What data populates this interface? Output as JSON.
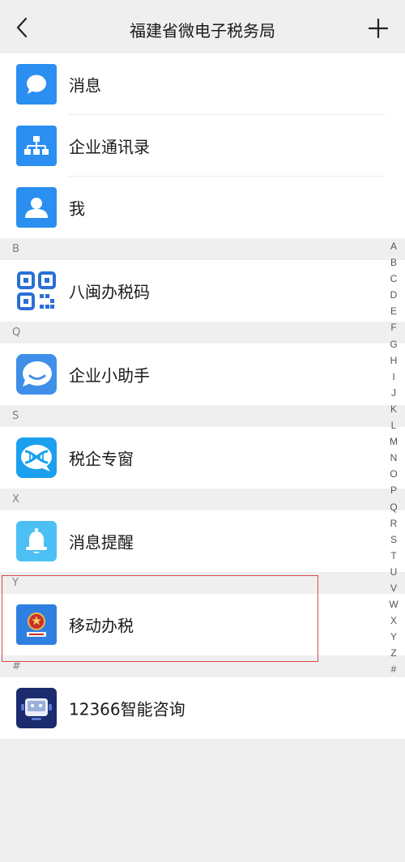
{
  "header": {
    "title": "福建省微电子税务局"
  },
  "top_items": [
    {
      "label": "消息",
      "icon": "chat-bubble-icon"
    },
    {
      "label": "企业通讯录",
      "icon": "org-chart-icon"
    },
    {
      "label": "我",
      "icon": "person-icon"
    }
  ],
  "sections": [
    {
      "letter": "B",
      "items": [
        {
          "label": "八闽办税码",
          "icon": "qr-code-icon"
        }
      ]
    },
    {
      "letter": "Q",
      "items": [
        {
          "label": "企业小助手",
          "icon": "smile-bubble-icon"
        }
      ]
    },
    {
      "letter": "S",
      "items": [
        {
          "label": "税企专窗",
          "icon": "dna-bubble-icon"
        }
      ]
    },
    {
      "letter": "X",
      "items": [
        {
          "label": "消息提醒",
          "icon": "bell-icon"
        }
      ]
    },
    {
      "letter": "Y",
      "items": [
        {
          "label": "移动办税",
          "icon": "tax-emblem-icon"
        }
      ]
    },
    {
      "letter": "#",
      "items": [
        {
          "label": "12366智能咨询",
          "icon": "robot-icon"
        }
      ]
    }
  ],
  "index_letters": [
    "A",
    "B",
    "C",
    "D",
    "E",
    "F",
    "G",
    "H",
    "I",
    "J",
    "K",
    "L",
    "M",
    "N",
    "O",
    "P",
    "Q",
    "R",
    "S",
    "T",
    "U",
    "V",
    "W",
    "X",
    "Y",
    "Z",
    "#"
  ],
  "colors": {
    "background": "#efeff0",
    "row": "#ffffff",
    "icon_blue": "#2a8ff0",
    "highlight": "#d84a4a"
  }
}
